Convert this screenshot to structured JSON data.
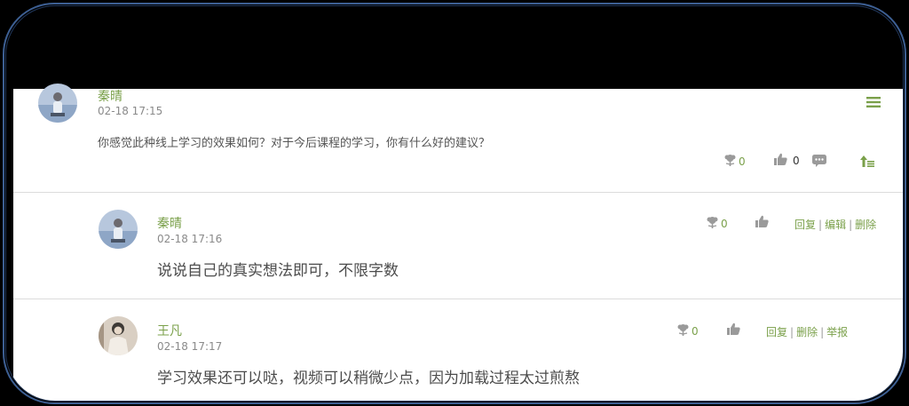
{
  "thread": {
    "author": "秦晴",
    "time": "02-18 17:15",
    "question": "你感觉此种线上学习的效果如何？对于今后课程的学习，你有什么好的建议？",
    "flower_count": "0",
    "like_count": "0"
  },
  "replies": [
    {
      "author": "秦晴",
      "time": "02-18 17:16",
      "text": "说说自己的真实想法即可，不限字数",
      "flower_count": "0",
      "actions": [
        "回复",
        "编辑",
        "删除"
      ]
    },
    {
      "author": "王凡",
      "time": "02-18 17:17",
      "text": "学习效果还可以哒，视频可以稍微少点，因为加载过程太过煎熬",
      "flower_count": "0",
      "actions": [
        "回复",
        "删除",
        "举报"
      ]
    }
  ],
  "colors": {
    "accent": "#7aa04a",
    "icon_gray": "#9a9a9a",
    "frame_border": "#3d5f93"
  },
  "icons": [
    "flower-icon",
    "thumbs-up-icon",
    "comment-icon",
    "menu-icon",
    "pin-top-icon"
  ]
}
